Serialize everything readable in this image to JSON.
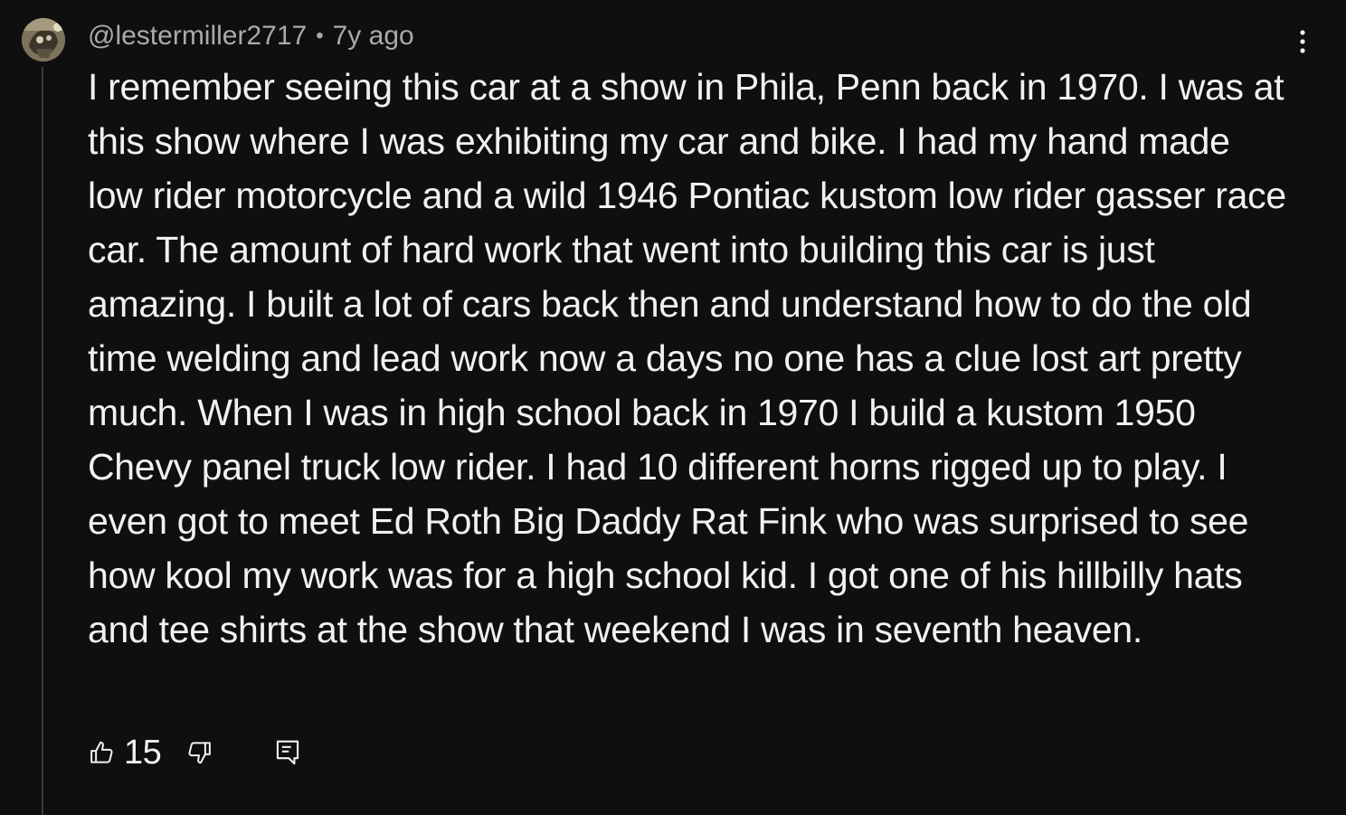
{
  "comment": {
    "author": "@lestermiller2717",
    "separator": "•",
    "time_ago": "7y ago",
    "text": "I remember seeing this car at a show in Phila, Penn back in 1970. I was at this show where I was exhibiting my car and bike. I had my hand made low rider motorcycle and a wild 1946 Pontiac kustom low rider gasser race car. The amount of hard work that went into building this car is just amazing. I built a lot of cars back then and understand how to do the old time welding and lead work now a days no one has a clue lost art pretty much. When I was in high school back in 1970 I build a kustom 1950 Chevy panel truck low rider. I had 10 different horns rigged up to play. I even got to meet Ed Roth Big Daddy Rat Fink who was surprised to see how kool my work was for a high school kid. I got one of his hillbilly hats and tee shirts at the show that weekend I was in seventh heaven.",
    "like_count": "15"
  },
  "icons": {
    "avatar": "avatar-image",
    "menu": "more-vertical-icon",
    "like": "thumbs-up-icon",
    "dislike": "thumbs-down-icon",
    "reply": "reply-comment-icon"
  },
  "colors": {
    "background": "#0f0f0f",
    "text_primary": "#f1f1f1",
    "text_secondary": "#aaaaaa",
    "thread_line": "#3a3a3a"
  }
}
